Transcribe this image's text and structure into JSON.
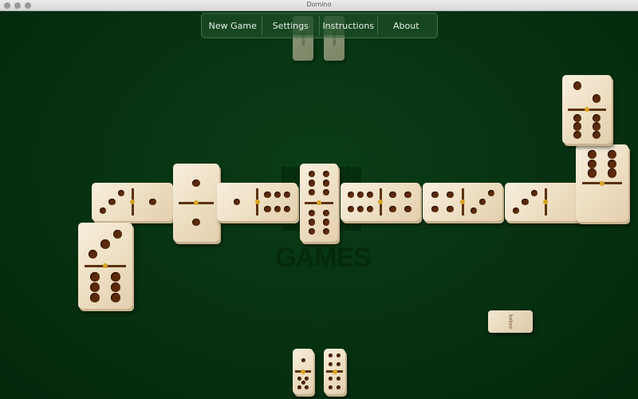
{
  "window": {
    "title": "Domino"
  },
  "menu": {
    "items": [
      {
        "label": "New Game"
      },
      {
        "label": "Settings"
      },
      {
        "label": "Instructions"
      },
      {
        "label": "About"
      }
    ]
  },
  "logo": {
    "text": "GAMES"
  },
  "board": {
    "tiles": [
      {
        "a": 3,
        "b": 1,
        "orientation": "horizontal"
      },
      {
        "a": 1,
        "b": 1,
        "orientation": "vertical"
      },
      {
        "a": 1,
        "b": 6,
        "orientation": "horizontal"
      },
      {
        "a": 6,
        "b": 6,
        "orientation": "vertical"
      },
      {
        "a": 6,
        "b": 4,
        "orientation": "horizontal"
      },
      {
        "a": 4,
        "b": 3,
        "orientation": "horizontal"
      },
      {
        "a": 3,
        "b": 0,
        "orientation": "horizontal"
      },
      {
        "a": 6,
        "b": 0,
        "orientation": "vertical"
      },
      {
        "a": 2,
        "b": 6,
        "orientation": "vertical"
      },
      {
        "a": 3,
        "b": 6,
        "orientation": "vertical"
      }
    ]
  },
  "player_hand": [
    {
      "a": 1,
      "b": 5
    },
    {
      "a": 4,
      "b": 4
    }
  ],
  "opponent_hand_count": 2,
  "boneyard": {
    "count": 1,
    "brand": "bakoo"
  },
  "colors": {
    "felt": "#06300f",
    "tile": "#f3e8d2",
    "pip": "#5a2a0a",
    "stud": "#d8a320"
  }
}
